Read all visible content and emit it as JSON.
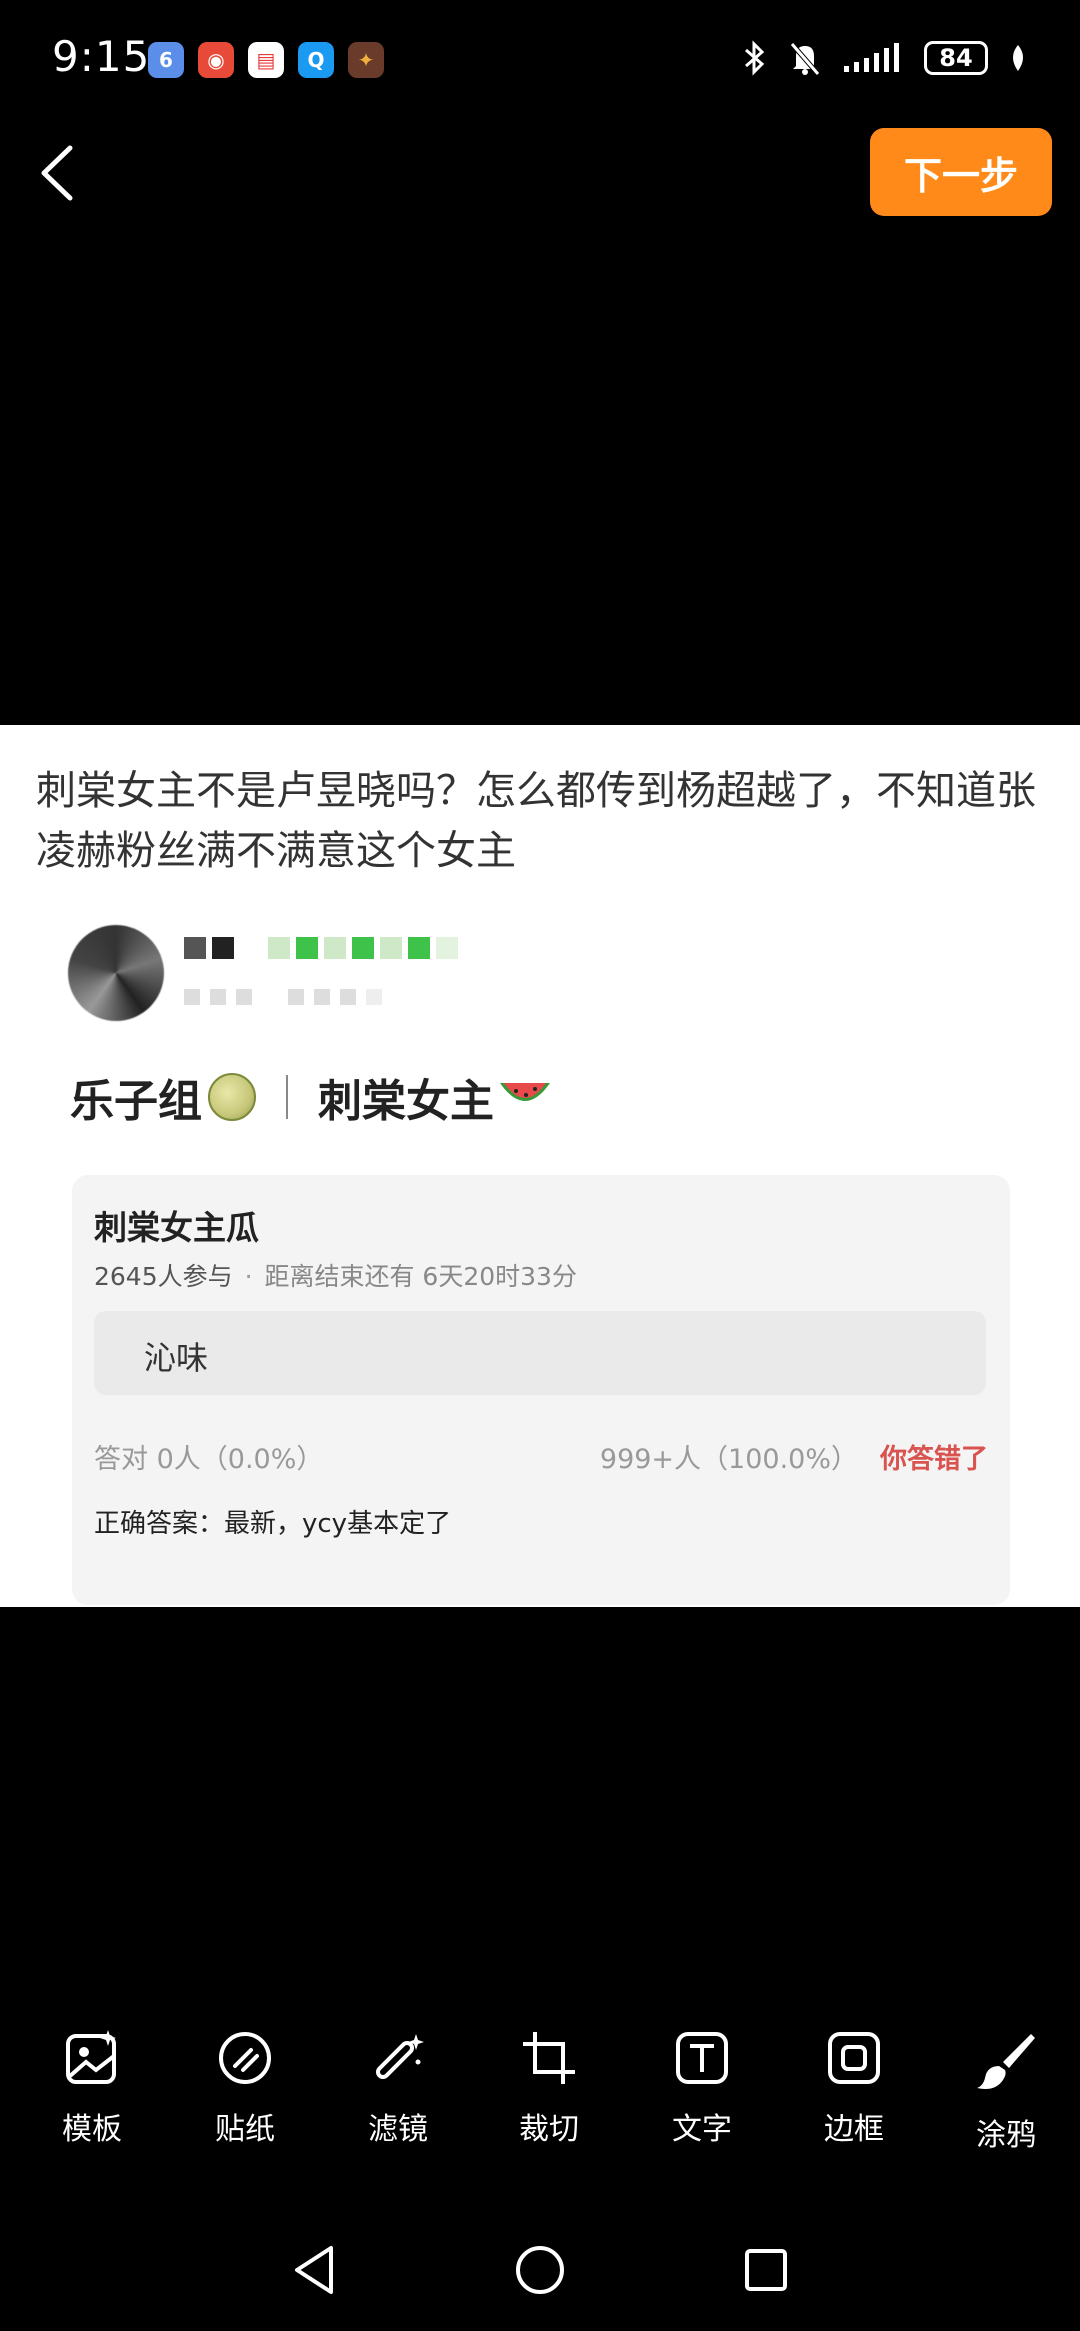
{
  "status_bar": {
    "time": "9:15",
    "battery": "84",
    "app_icons": [
      {
        "name": "six-app-icon",
        "glyph": "6",
        "color": "#5a8ee8"
      },
      {
        "name": "browser-app-icon",
        "glyph": "◉",
        "color": "#e84a3a"
      },
      {
        "name": "calendar-app-icon",
        "glyph": "▤",
        "color": "#e83a3a"
      },
      {
        "name": "search-app-icon",
        "glyph": "Q",
        "color": "#1a9af0"
      },
      {
        "name": "game-app-icon",
        "glyph": "✦",
        "color": "#c0562a"
      }
    ]
  },
  "top_nav": {
    "next_label": "下一步"
  },
  "image": {
    "post_text": "刺棠女主不是卢昱晓吗？怎么都传到杨超越了，不知道张凌赫粉丝满不满意这个女主",
    "topic_left": "乐子组",
    "topic_right": "刺棠女主",
    "poll": {
      "title": "刺棠女主瓜",
      "participants": "2645人参与",
      "deadline": "距离结束还有 6天20时33分",
      "option": "沁味",
      "correct_stat": "答对  0人（0.0%）",
      "wrong_stat": "999+人（100.0%）",
      "wrong_label": "你答错了",
      "answer": "正确答案：最新，ycy基本定了"
    }
  },
  "toolbar": {
    "items": [
      {
        "label": "模板",
        "icon": "template-icon"
      },
      {
        "label": "贴纸",
        "icon": "sticker-icon"
      },
      {
        "label": "滤镜",
        "icon": "filter-icon"
      },
      {
        "label": "裁切",
        "icon": "crop-icon"
      },
      {
        "label": "文字",
        "icon": "text-icon"
      },
      {
        "label": "边框",
        "icon": "frame-icon"
      },
      {
        "label": "涂鸦",
        "icon": "brush-icon"
      }
    ]
  },
  "colors": {
    "accent": "#ff8a1a",
    "wrong": "#d9534f",
    "background": "#000000"
  }
}
